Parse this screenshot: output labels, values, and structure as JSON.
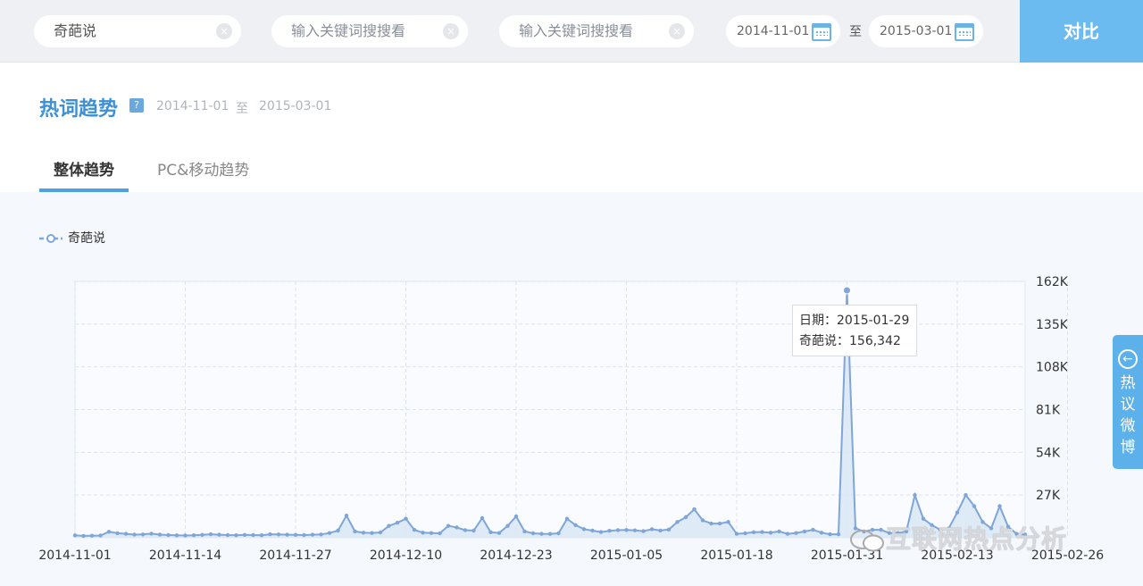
{
  "search": {
    "term1": "奇葩说",
    "term2_placeholder": "输入关键词搜搜看",
    "term3_placeholder": "输入关键词搜搜看",
    "start_date": "2014-11-01",
    "to_label": "至",
    "end_date": "2015-03-01",
    "compare_label": "对比"
  },
  "header": {
    "title": "热词趋势",
    "help": "?",
    "range_start": "2014-11-01",
    "range_sep": "至",
    "range_end": "2015-03-01"
  },
  "tabs": [
    {
      "label": "整体趋势",
      "active": true
    },
    {
      "label": "PC&移动趋势",
      "active": false
    }
  ],
  "tooltip": {
    "date_label": "日期：2015-01-29",
    "value_label": "奇葩说：156,342"
  },
  "side_tab": {
    "label": "热议微博"
  },
  "watermark": "互联网热点分析",
  "colors": {
    "series": "#7ea6d8",
    "accent": "#4ea1e2",
    "compare": "#6cbbf0"
  },
  "chart_data": {
    "type": "area",
    "series": [
      {
        "name": "奇葩说",
        "x_start": "2014-11-01",
        "values": [
          1500,
          1200,
          1300,
          1400,
          3800,
          2900,
          2500,
          2000,
          2100,
          2600,
          2000,
          1700,
          1500,
          1400,
          1600,
          1800,
          2200,
          1900,
          1700,
          1600,
          1800,
          1700,
          1600,
          2200,
          2100,
          1900,
          1800,
          1700,
          1900,
          2100,
          3000,
          4500,
          14000,
          4000,
          3200,
          3000,
          3400,
          7500,
          9500,
          12000,
          5000,
          3200,
          3000,
          2800,
          7500,
          6500,
          4800,
          4500,
          12500,
          3500,
          3000,
          7500,
          13500,
          4000,
          2800,
          2500,
          2400,
          2800,
          12000,
          8000,
          5500,
          4500,
          3600,
          4400,
          4800,
          4900,
          4700,
          4200,
          5400,
          4600,
          5200,
          10000,
          13000,
          18000,
          11000,
          9000,
          9000,
          10000,
          2500,
          2800,
          3500,
          3600,
          3200,
          4000,
          2500,
          3000,
          4000,
          5000,
          3200,
          2200,
          2200,
          156342,
          6000,
          4000,
          5000,
          5000,
          3000,
          3000,
          4000,
          27000,
          12000,
          8000,
          5000,
          6000,
          16000,
          27000,
          20000,
          10000,
          6000,
          20000,
          7000,
          2500,
          2000
        ]
      }
    ],
    "x_tick_labels": [
      "2014-11-01",
      "2014-11-14",
      "2014-11-27",
      "2014-12-10",
      "2014-12-23",
      "2015-01-05",
      "2015-01-18",
      "2015-01-31",
      "2015-02-13",
      "2015-02-26"
    ],
    "y_tick_labels": [
      "162K",
      "135K",
      "108K",
      "81K",
      "54K",
      "27K"
    ],
    "y_ticks": [
      162000,
      135000,
      108000,
      81000,
      54000,
      27000
    ],
    "ylim": [
      0,
      162000
    ],
    "grid": true,
    "legend_position": "top-left",
    "highlight": {
      "date": "2015-01-29",
      "value": 156342
    }
  }
}
